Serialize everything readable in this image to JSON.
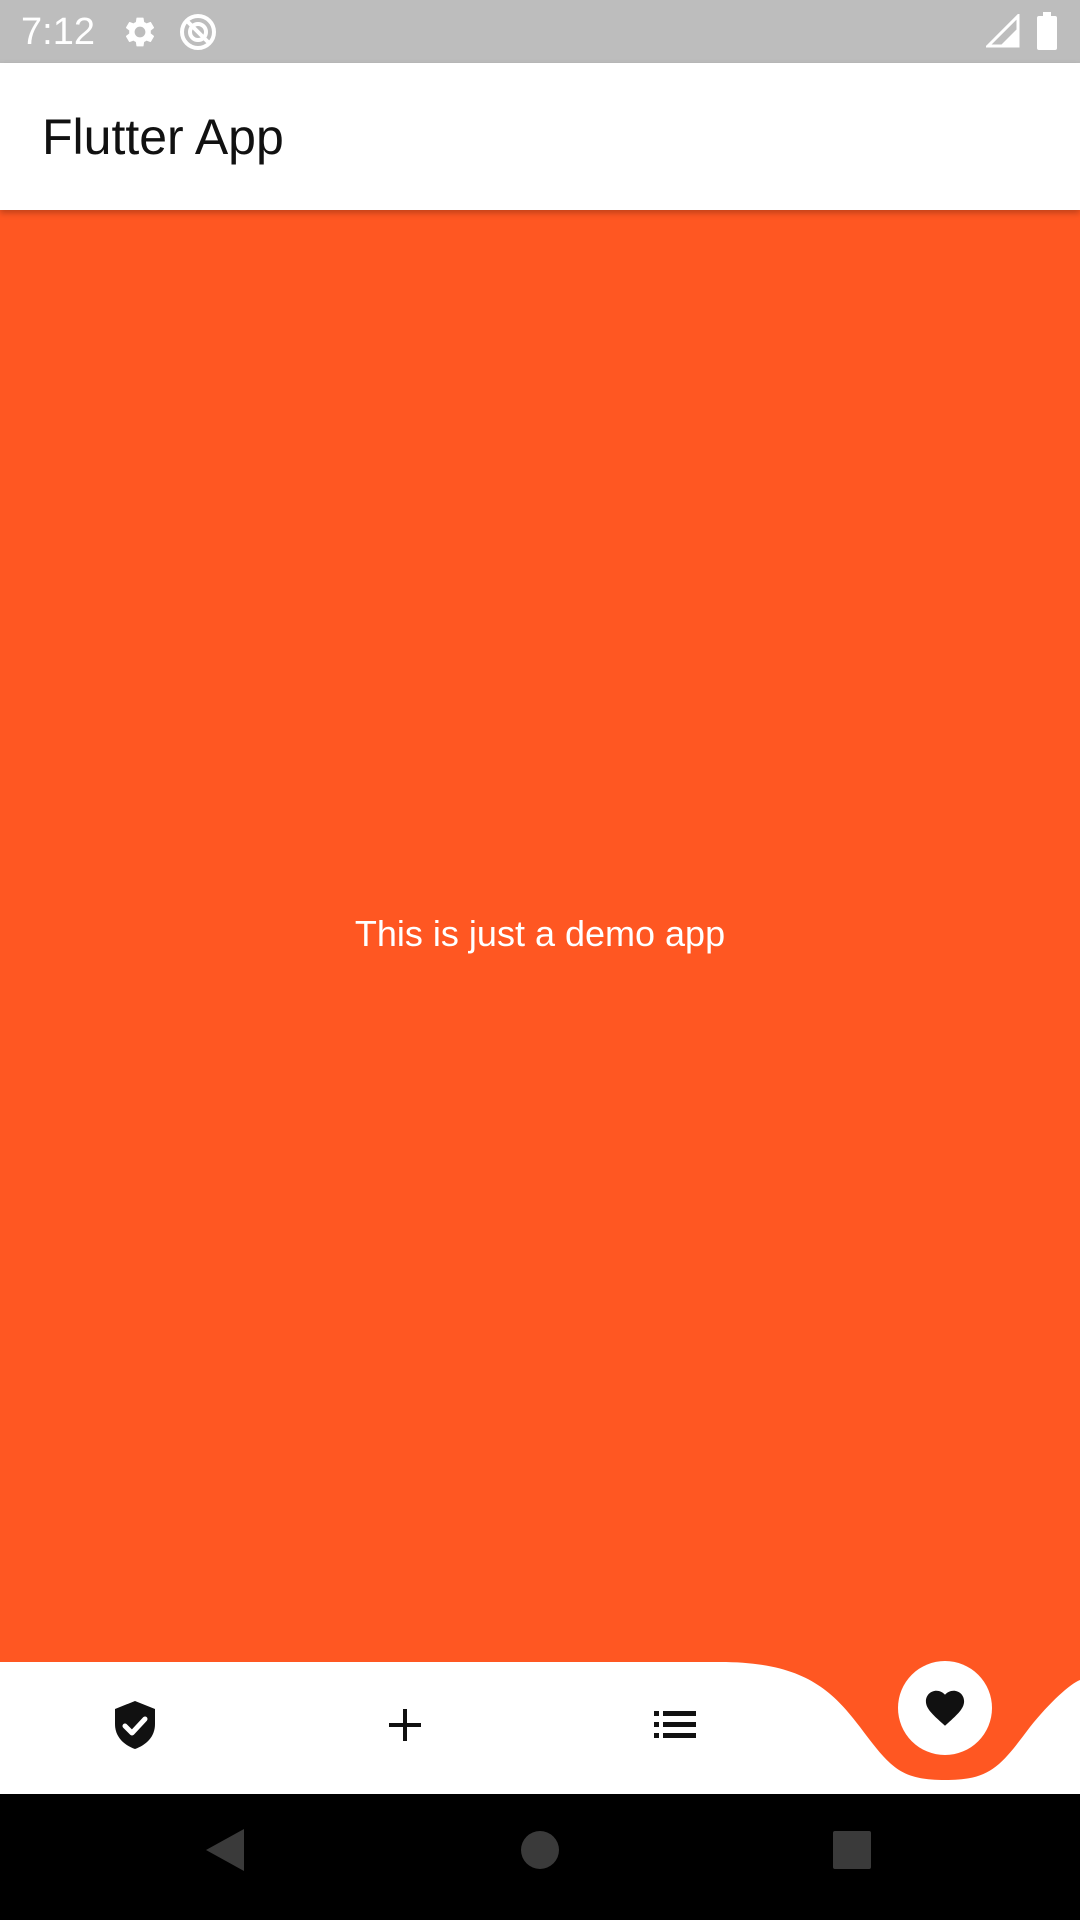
{
  "status_bar": {
    "time": "7:12",
    "icons": [
      "settings-icon",
      "sync-icon",
      "signal-icon",
      "battery-icon"
    ]
  },
  "app_bar": {
    "title": "Flutter App"
  },
  "content": {
    "message": "This is just a demo app",
    "background_color": "#ff5722"
  },
  "bottom_nav": {
    "items": [
      {
        "icon": "verified-shield-icon"
      },
      {
        "icon": "add-icon"
      },
      {
        "icon": "list-icon"
      },
      {
        "icon": "heart-icon",
        "selected": true
      }
    ]
  },
  "system_nav": {
    "buttons": [
      "back",
      "home",
      "recents"
    ]
  },
  "colors": {
    "accent": "#ff5722",
    "status_bar": "#bdbdbd",
    "nav_background": "#ffffff"
  }
}
